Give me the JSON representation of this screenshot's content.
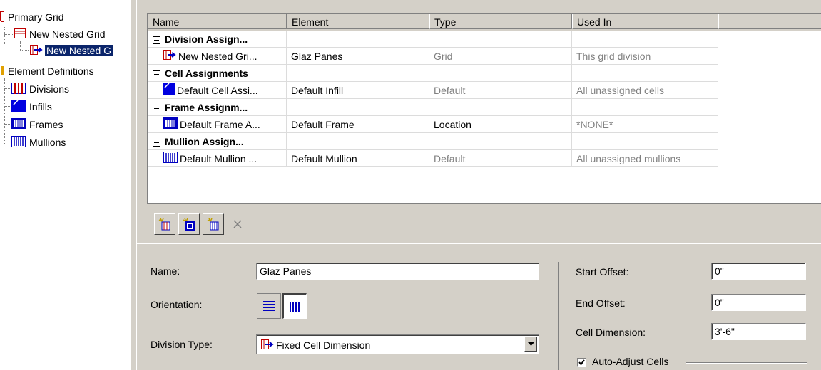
{
  "tree": {
    "items": [
      {
        "label": "Primary Grid"
      },
      {
        "label": "New Nested Grid"
      },
      {
        "label": "New Nested G"
      },
      {
        "label": "Element Definitions"
      },
      {
        "label": "Divisions"
      },
      {
        "label": "Infills"
      },
      {
        "label": "Frames"
      },
      {
        "label": "Mullions"
      }
    ]
  },
  "grid": {
    "headers": [
      "Name",
      "Element",
      "Type",
      "Used In"
    ],
    "groups": [
      {
        "label": "Division Assign...",
        "row": {
          "name": "New Nested Gri...",
          "element": "Glaz Panes",
          "type": "Grid",
          "used_in": "This grid division"
        }
      },
      {
        "label": "Cell Assignments",
        "row": {
          "name": "Default Cell Assi...",
          "element": "Default Infill",
          "type": "Default",
          "used_in": "All unassigned cells"
        }
      },
      {
        "label": "Frame Assignm...",
        "row": {
          "name": "Default Frame A...",
          "element": "Default Frame",
          "type": "Location",
          "used_in": "*NONE*"
        }
      },
      {
        "label": "Mullion Assign...",
        "row": {
          "name": "Default Mullion ...",
          "element": "Default Mullion",
          "type": "Default",
          "used_in": "All unassigned mullions"
        }
      }
    ]
  },
  "toolbar": {
    "icons": [
      "new-division-icon",
      "new-cell-icon",
      "new-frame-icon",
      "delete-icon"
    ]
  },
  "form": {
    "name_label": "Name:",
    "name_value": "Glaz Panes",
    "orientation_label": "Orientation:",
    "division_type_label": "Division Type:",
    "division_type_value": "Fixed Cell Dimension",
    "start_offset_label": "Start Offset:",
    "start_offset_value": "0\"",
    "end_offset_label": "End Offset:",
    "end_offset_value": "0\"",
    "cell_dimension_label": "Cell Dimension:",
    "cell_dimension_value": "3'-6\"",
    "auto_adjust_label": "Auto-Adjust Cells",
    "auto_adjust_checked": true
  },
  "colors": {
    "selection": "#0a246a",
    "accent_red": "#c00000",
    "accent_blue": "#0000c0",
    "face": "#d4d0c8"
  }
}
